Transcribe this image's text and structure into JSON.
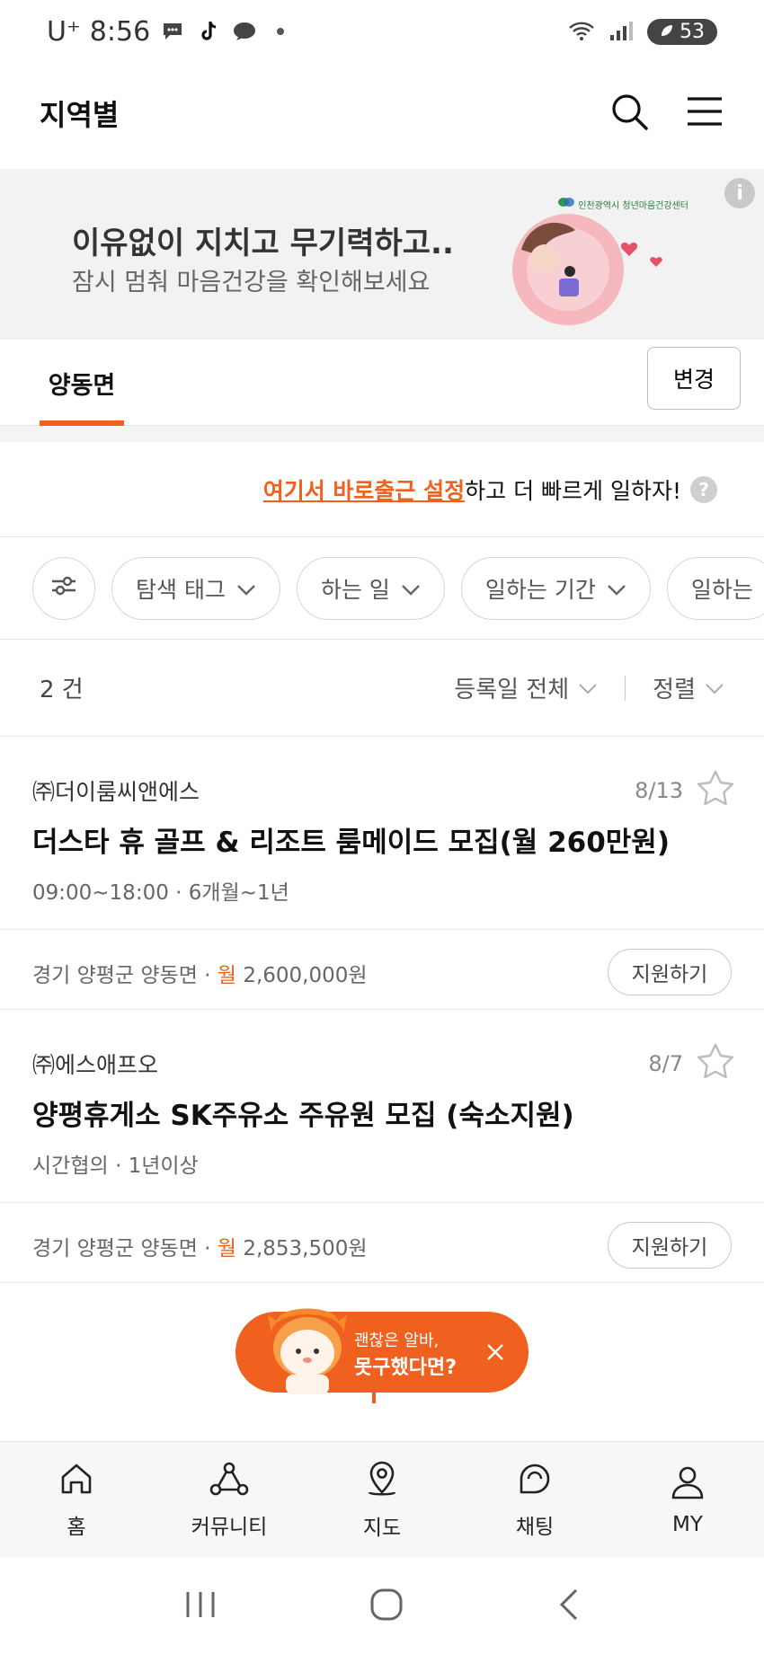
{
  "status": {
    "carrier": "U⁺",
    "time": "8:56",
    "battery": "53"
  },
  "header": {
    "title": "지역별"
  },
  "banner": {
    "line1": "이유없이 지치고 무기력하고..",
    "line2": "잠시 멈춰 마음건강을 확인해보세요",
    "org": "인천광역시 청년마음건강센터"
  },
  "region": {
    "tab": "양동면",
    "change_label": "변경"
  },
  "commute": {
    "link": "여기서 바로출근 설정",
    "rest": "하고 더 빠르게 일하자!"
  },
  "filters": [
    "탐색 태그",
    "하는 일",
    "일하는 기간",
    "일하는"
  ],
  "results": {
    "count": "2 건",
    "date_filter": "등록일 전체",
    "sort": "정렬"
  },
  "jobs": [
    {
      "company": "㈜더이룸씨앤에스",
      "date": "8/13",
      "title": "더스타 휴 골프 & 리조트 룸메이드 모집(월 260만원)",
      "meta": "09:00~18:00 · 6개월~1년",
      "location": "경기 양평군 양동면 · ",
      "wage_label": "월",
      "wage": " 2,600,000원",
      "apply": "지원하기"
    },
    {
      "company": "㈜에스애프오",
      "date": "8/7",
      "title": "양평휴게소 SK주유소 주유원 모집 (숙소지원)",
      "meta": "시간협의 · 1년이상",
      "location": "경기 양평군 양동면 · ",
      "wage_label": "월",
      "wage": " 2,853,500원",
      "apply": "지원하기"
    }
  ],
  "promo": {
    "line1": "괜찮은 알바,",
    "line2": "못구했다면?"
  },
  "nav": [
    {
      "label": "홈",
      "icon": "home-icon"
    },
    {
      "label": "커뮤니티",
      "icon": "community-icon"
    },
    {
      "label": "지도",
      "icon": "map-pin-icon"
    },
    {
      "label": "채팅",
      "icon": "chat-icon"
    },
    {
      "label": "MY",
      "icon": "user-icon"
    }
  ],
  "colors": {
    "accent": "#f0611f",
    "banner_bg": "#f2f2f2",
    "nav_bg": "#f7f7f7"
  }
}
